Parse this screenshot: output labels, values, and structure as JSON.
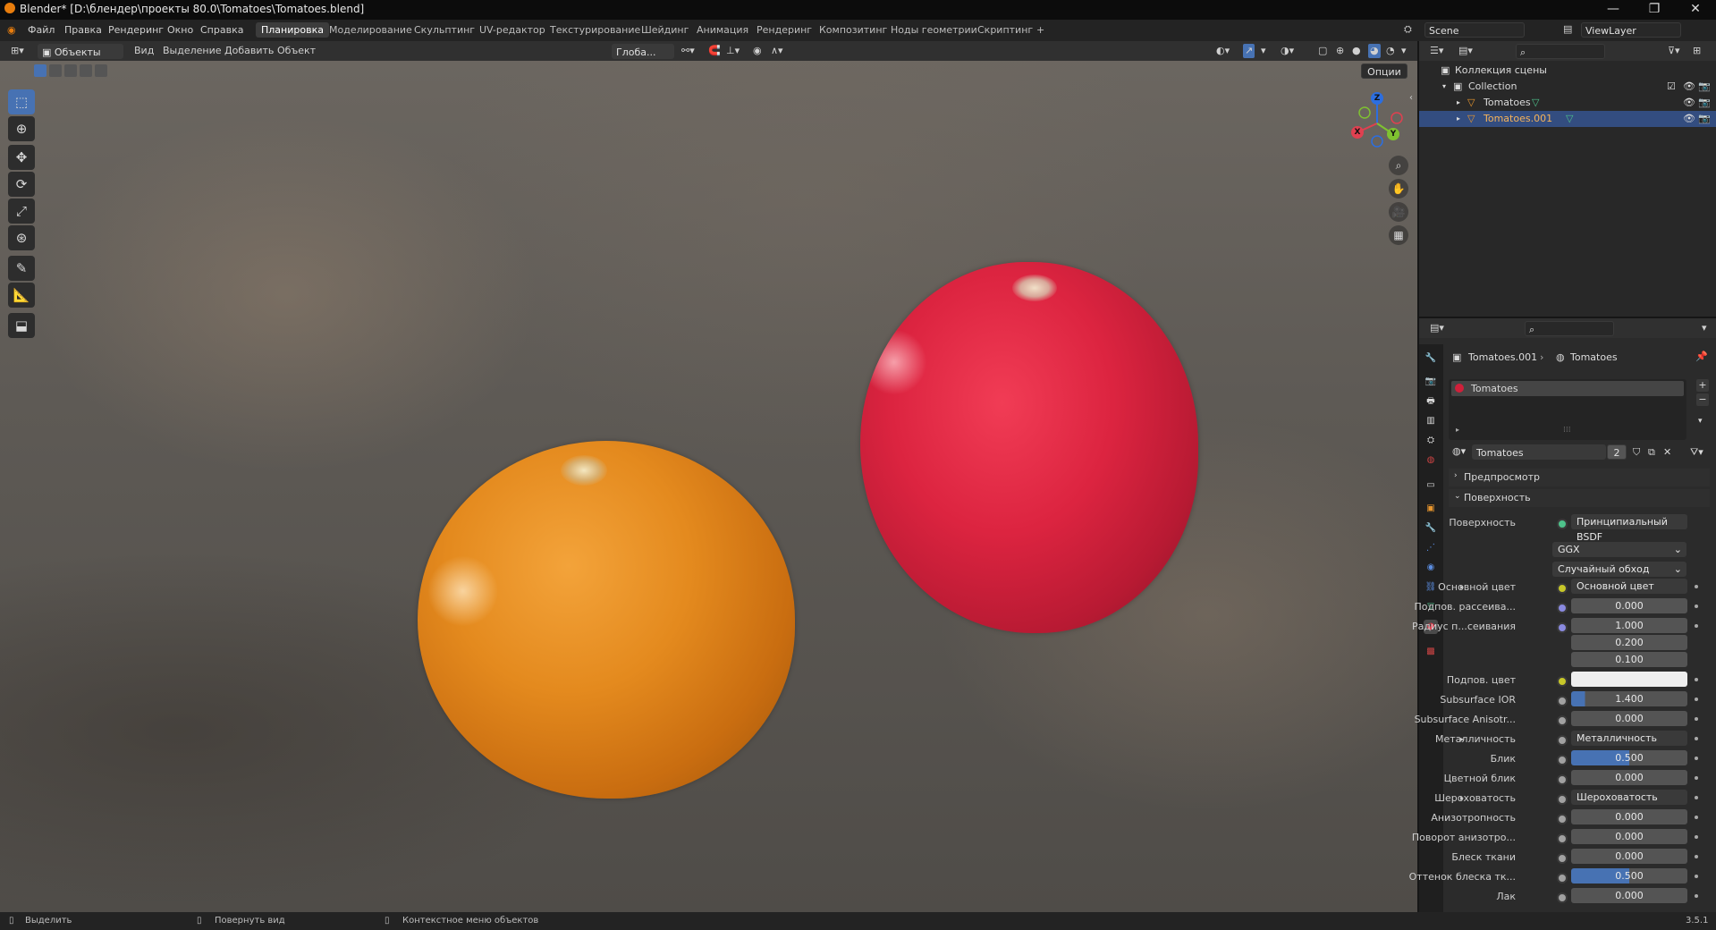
{
  "window": {
    "title": "Blender* [D:\\блендер\\проекты 80.0\\Tomatoes\\Tomatoes.blend]",
    "minimize": "—",
    "maximize": "❐",
    "close": "✕"
  },
  "menu": {
    "file": "Файл",
    "edit": "Правка",
    "render": "Рендеринг",
    "window": "Окно",
    "help": "Справка"
  },
  "workspaces": [
    "Планировка",
    "Моделирование",
    "Скульптинг",
    "UV-редактор",
    "Текстурирование",
    "Шейдинг",
    "Анимация",
    "Рендеринг",
    "Композитинг",
    "Ноды геометрии",
    "Скриптинг"
  ],
  "workspace_add": "+",
  "scene": {
    "name": "Scene",
    "view_layer": "ViewLayer"
  },
  "viewport_header": {
    "mode": "Объекты",
    "view": "Вид",
    "select": "Выделение",
    "add": "Добавить",
    "object": "Объект",
    "orientation": "Глоба...",
    "options": "Опции"
  },
  "gizmo": {
    "x": "X",
    "y": "Y",
    "z": "Z"
  },
  "outliner": {
    "scene_collection": "Коллекция сцены",
    "collection": "Collection",
    "items": [
      "Tomatoes",
      "Tomatoes.001"
    ]
  },
  "properties": {
    "breadcrumb_object": "Tomatoes.001",
    "breadcrumb_material": "Tomatoes",
    "slot": "Tomatoes",
    "material_name": "Tomatoes",
    "users": "2",
    "preview": "Предпросмотр",
    "surface_panel": "Поверхность",
    "surface_label": "Поверхность",
    "surface_value": "Принципиальный BSDF",
    "distribution": "GGX",
    "subsurface_method": "Случайный обход",
    "rows": [
      {
        "label": "Основной цвет",
        "value": "Основной цвет",
        "kind": "link"
      },
      {
        "label": "Подпов. рассеива...",
        "value": "0.000",
        "kind": "num"
      },
      {
        "label": "Радиус п...сеивания",
        "value": "1.000",
        "kind": "num"
      },
      {
        "label": "",
        "value": "0.200",
        "kind": "num"
      },
      {
        "label": "",
        "value": "0.100",
        "kind": "num"
      },
      {
        "label": "Подпов. цвет",
        "value": "",
        "kind": "color"
      },
      {
        "label": "Subsurface IOR",
        "value": "1.400",
        "kind": "num"
      },
      {
        "label": "Subsurface Anisotr...",
        "value": "0.000",
        "kind": "num"
      },
      {
        "label": "Металличность",
        "value": "Металличность",
        "kind": "link"
      },
      {
        "label": "Блик",
        "value": "0.500",
        "kind": "blue"
      },
      {
        "label": "Цветной блик",
        "value": "0.000",
        "kind": "num"
      },
      {
        "label": "Шероховатость",
        "value": "Шероховатость",
        "kind": "link"
      },
      {
        "label": "Анизотропность",
        "value": "0.000",
        "kind": "num"
      },
      {
        "label": "Поворот анизотро...",
        "value": "0.000",
        "kind": "num"
      },
      {
        "label": "Блеск ткани",
        "value": "0.000",
        "kind": "num"
      },
      {
        "label": "Оттенок блеска тк...",
        "value": "0.500",
        "kind": "blue"
      },
      {
        "label": "Лак",
        "value": "0.000",
        "kind": "num"
      }
    ]
  },
  "status": {
    "select": "Выделить",
    "rotate": "Повернуть вид",
    "context_menu": "Контекстное меню объектов",
    "version": "3.5.1"
  },
  "colors": {
    "accent": "#4772b3",
    "tomato_orange": "#e48a1e",
    "tomato_red": "#dc2440",
    "selected_row": "#334d80"
  }
}
